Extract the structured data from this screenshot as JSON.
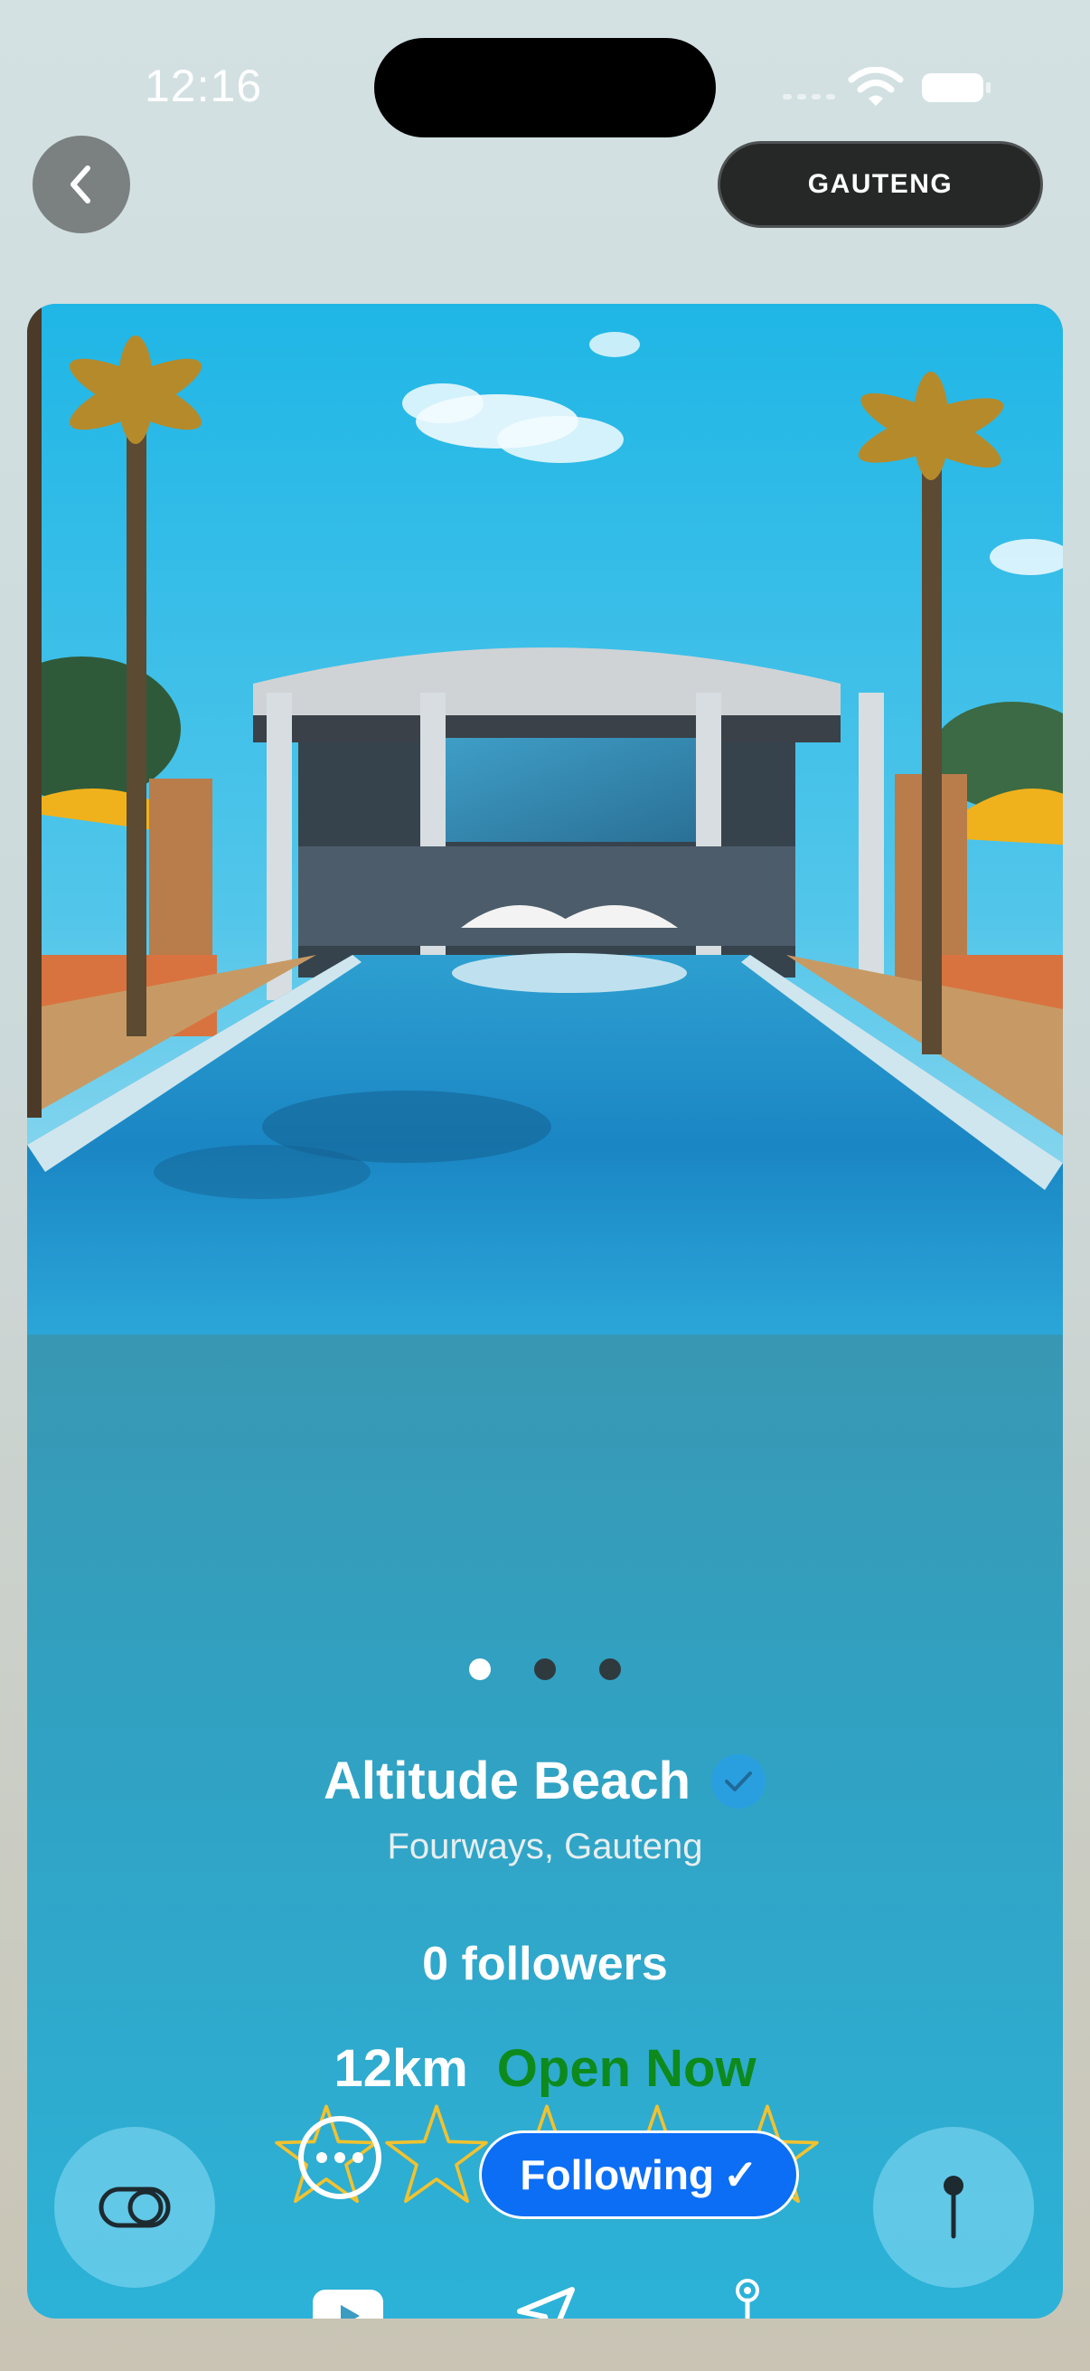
{
  "status_bar": {
    "time": "12:16"
  },
  "header": {
    "region_label": "GAUTENG"
  },
  "venue": {
    "name": "Altitude Beach",
    "verified": true,
    "location": "Fourways, Gauteng",
    "followers": "0 followers",
    "distance": "12km",
    "open_status": "Open Now",
    "rating": 0,
    "rating_max": 5,
    "photo_index": 1,
    "photo_count": 3
  },
  "actions": {
    "icons": [
      "youtube-icon",
      "navigation-arrow-icon",
      "map-pin-icon"
    ]
  },
  "bottom_bar": {
    "following_label": "Following",
    "following_check": "✓"
  },
  "colors": {
    "open_now": "#0d8a1b",
    "following_button": "#0b6ef5",
    "verified_badge": "#2a9fe0",
    "star_outline": "#f2c22e"
  }
}
